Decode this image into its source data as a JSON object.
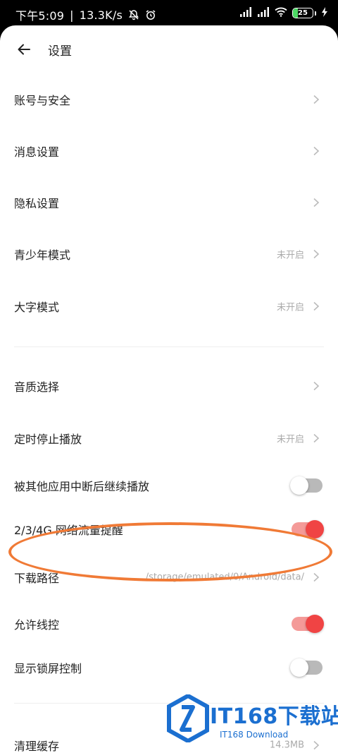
{
  "status_bar": {
    "time": "下午5:09",
    "separator": "|",
    "speed": "13.3K/s",
    "battery": "25"
  },
  "header": {
    "title": "设置"
  },
  "rows": {
    "account": {
      "label": "账号与安全"
    },
    "messages": {
      "label": "消息设置"
    },
    "privacy": {
      "label": "隐私设置"
    },
    "teen": {
      "label": "青少年模式",
      "value": "未开启"
    },
    "large_font": {
      "label": "大字模式",
      "value": "未开启"
    },
    "quality": {
      "label": "音质选择"
    },
    "timer": {
      "label": "定时停止播放",
      "value": "未开启"
    },
    "resume": {
      "label": "被其他应用中断后继续播放",
      "enabled": false
    },
    "network": {
      "label": "2/3/4G 网络流量提醒",
      "enabled": true
    },
    "download_path": {
      "label": "下载路径",
      "value": "/storage/emulated/0/Android/data/"
    },
    "wire_control": {
      "label": "允许线控",
      "enabled": true
    },
    "lock_screen": {
      "label": "显示锁屏控制",
      "enabled": false
    },
    "clear_cache": {
      "label": "清理缓存",
      "value": "14.3MB"
    }
  },
  "watermark": {
    "text": "IT168下载站",
    "sub": "IT168 Download"
  },
  "colors": {
    "accent": "#f04444",
    "annotation": "#f07a36",
    "watermark": "#1b6fd0"
  }
}
